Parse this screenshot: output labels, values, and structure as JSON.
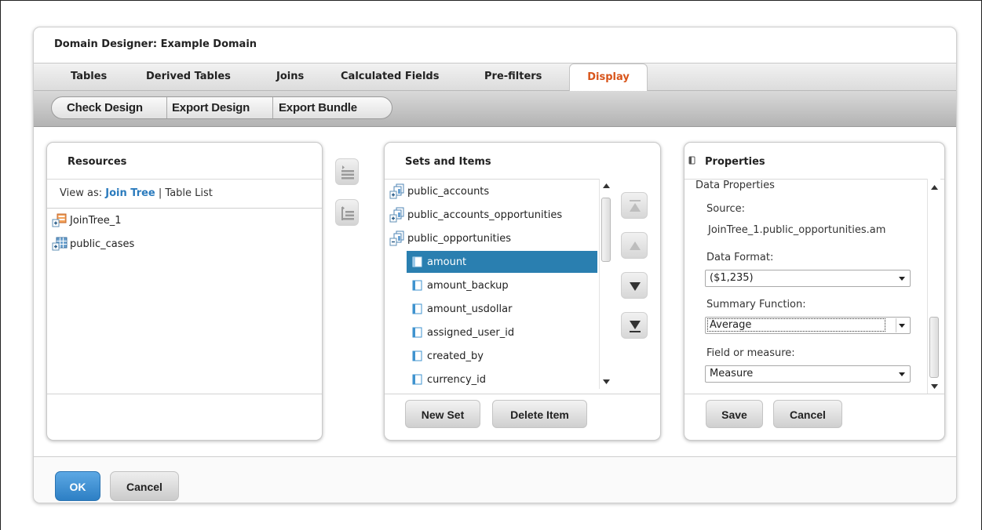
{
  "dialog": {
    "title": "Domain Designer: Example Domain"
  },
  "tabs": [
    {
      "label": "Tables"
    },
    {
      "label": "Derived Tables"
    },
    {
      "label": "Joins"
    },
    {
      "label": "Calculated Fields"
    },
    {
      "label": "Pre-filters"
    },
    {
      "label": "Display",
      "active": true
    }
  ],
  "toolbar": {
    "check_design": "Check Design",
    "export_design": "Export Design",
    "export_bundle": "Export Bundle"
  },
  "resources": {
    "title": "Resources",
    "view_as_label": "View as:",
    "join_tree_link": "Join Tree",
    "separator": "|",
    "table_list_link": "Table List",
    "items": [
      {
        "label": "JoinTree_1",
        "icon": "join-tree-icon"
      },
      {
        "label": "public_cases",
        "icon": "table-icon"
      }
    ]
  },
  "sets": {
    "title": "Sets and Items",
    "items": [
      {
        "label": "public_accounts",
        "icon": "set-expand-icon"
      },
      {
        "label": "public_accounts_opportunities",
        "icon": "set-expand-icon"
      },
      {
        "label": "public_opportunities",
        "icon": "set-collapse-icon"
      },
      {
        "label": "amount",
        "icon": "item-icon",
        "selected": true
      },
      {
        "label": "amount_backup",
        "icon": "item-icon"
      },
      {
        "label": "amount_usdollar",
        "icon": "item-icon"
      },
      {
        "label": "assigned_user_id",
        "icon": "item-icon"
      },
      {
        "label": "created_by",
        "icon": "item-icon"
      },
      {
        "label": "currency_id",
        "icon": "item-icon"
      }
    ],
    "new_set": "New Set",
    "delete_item": "Delete Item"
  },
  "properties": {
    "title": "Properties",
    "section": "Data Properties",
    "source_label": "Source:",
    "source_value": "JoinTree_1.public_opportunities.am",
    "data_format_label": "Data Format:",
    "data_format_value": "($1,235)",
    "summary_label": "Summary Function:",
    "summary_value": "Average",
    "field_label": "Field or measure:",
    "field_value": "Measure",
    "save": "Save",
    "cancel": "Cancel"
  },
  "footer": {
    "ok": "OK",
    "cancel": "Cancel"
  },
  "colors": {
    "accent_blue": "#2a7fb0",
    "active_tab": "#d8541a",
    "link": "#2b7bbd"
  }
}
